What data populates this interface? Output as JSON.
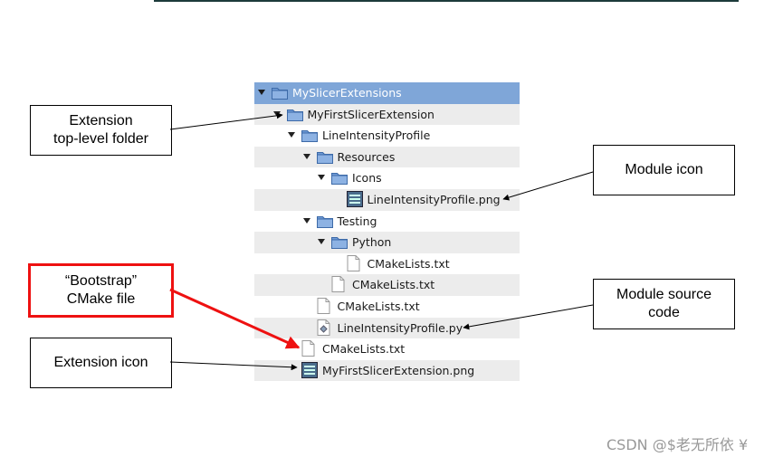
{
  "tree": [
    {
      "name": "MySlicerExtensions",
      "type": "folder",
      "depth": 0,
      "expanded": true,
      "selected": true
    },
    {
      "name": "MyFirstSlicerExtension",
      "type": "folder",
      "depth": 1,
      "expanded": true
    },
    {
      "name": "LineIntensityProfile",
      "type": "folder",
      "depth": 2,
      "expanded": true
    },
    {
      "name": "Resources",
      "type": "folder",
      "depth": 3,
      "expanded": true
    },
    {
      "name": "Icons",
      "type": "folder",
      "depth": 4,
      "expanded": true
    },
    {
      "name": "LineIntensityProfile.png",
      "type": "image",
      "depth": 5
    },
    {
      "name": "Testing",
      "type": "folder",
      "depth": 3,
      "expanded": true
    },
    {
      "name": "Python",
      "type": "folder",
      "depth": 4,
      "expanded": true
    },
    {
      "name": "CMakeLists.txt",
      "type": "text",
      "depth": 5
    },
    {
      "name": "CMakeLists.txt",
      "type": "text",
      "depth": 4
    },
    {
      "name": "CMakeLists.txt",
      "type": "text",
      "depth": 3
    },
    {
      "name": "LineIntensityProfile.py",
      "type": "python",
      "depth": 3
    },
    {
      "name": "CMakeLists.txt",
      "type": "text",
      "depth": 2
    },
    {
      "name": "MyFirstSlicerExtension.png",
      "type": "image",
      "depth": 2
    }
  ],
  "callouts": {
    "extension_folder": {
      "line1": "Extension",
      "line2": "top-level folder"
    },
    "module_icon": {
      "line1": "Module icon"
    },
    "bootstrap": {
      "line1": "“Bootstrap”",
      "line2": "CMake file"
    },
    "module_source": {
      "line1": "Module source",
      "line2": "code"
    },
    "extension_icon": {
      "line1": "Extension icon"
    }
  },
  "watermark": "CSDN @$老无所依 ¥",
  "colors": {
    "selected_row": "#7fa6d8",
    "alt_row": "#ececec",
    "folder": "#6f9bd6",
    "highlight_callout": "#ee1111"
  }
}
